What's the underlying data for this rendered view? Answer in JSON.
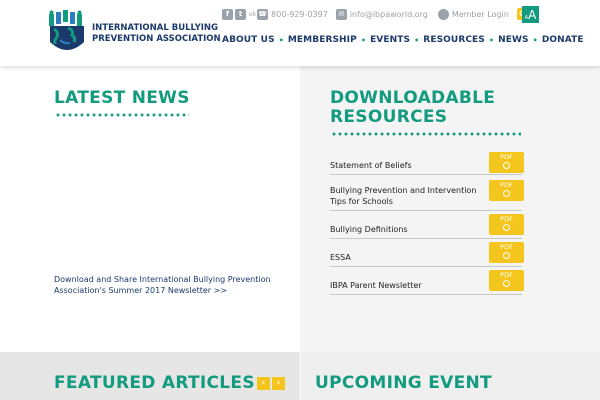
{
  "brand": {
    "name_line1": "INTERNATIONAL BULLYING",
    "name_line2": "PREVENTION ASSOCIATION"
  },
  "topbar": {
    "facebook_icon": "facebook-icon",
    "twitter_icon": "twitter-icon",
    "twitter_text": "ok",
    "phone": "800-929-0397",
    "email": "info@ibpaworld.org",
    "login": "Member Login",
    "font_small": "A",
    "font_large": "A"
  },
  "nav": {
    "items": [
      "ABOUT US",
      "MEMBERSHIP",
      "EVENTS",
      "RESOURCES",
      "NEWS",
      "DONATE"
    ]
  },
  "latest_news": {
    "title": "LATEST NEWS",
    "link_text": "Download and Share International Bullying Prevention Association's Summer 2017 Newsletter >>"
  },
  "resources": {
    "title_line1": "DOWNLOADABLE",
    "title_line2": "RESOURCES",
    "badge_label": "PDF",
    "items": [
      {
        "label": "Statement of Beliefs"
      },
      {
        "label": "Bullying Prevention and Intervention Tips for Schools"
      },
      {
        "label": "Bullying Definitions"
      },
      {
        "label": "ESSA"
      },
      {
        "label": "IBPA Parent Newsletter"
      }
    ]
  },
  "featured": {
    "title": "FEATURED ARTICLES",
    "prev": "‹",
    "next": "›"
  },
  "upcoming": {
    "title": "UPCOMING EVENT"
  },
  "colors": {
    "teal": "#139b7f",
    "navy": "#1b3a6b",
    "yellow": "#f4c51c"
  }
}
